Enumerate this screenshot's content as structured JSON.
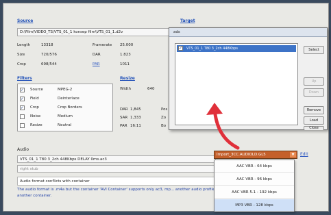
{
  "source": {
    "title": "Source",
    "path": "D:\\Film\\VIDEO_TS\\VTS_01_1 konsep film\\VTS_01_1.d2v",
    "length_label": "Length",
    "length_value": "13318",
    "framerate_label": "Framerate",
    "framerate_value": "25.000",
    "size_label": "Size",
    "size_value": "720/576",
    "dar_label": "DAR",
    "dar_value": "1.823",
    "crop_label": "Crop",
    "crop_value": "698/544",
    "par_label": "PAR",
    "par_value": "1011"
  },
  "target": {
    "title": "Target"
  },
  "filters": {
    "title": "Filters",
    "rows": [
      {
        "checked": true,
        "name": "Source",
        "value": "MPEG-2"
      },
      {
        "checked": true,
        "name": "Field",
        "value": "Deinterlace"
      },
      {
        "checked": true,
        "name": "Crop",
        "value": "Crop Borders"
      },
      {
        "checked": false,
        "name": "Noise",
        "value": "Medium"
      },
      {
        "checked": false,
        "name": "Resize",
        "value": "Neutral"
      }
    ]
  },
  "resize": {
    "title": "Resize",
    "width_label": "Width",
    "width_value": "640",
    "dar_label": "DAR",
    "dar_value": "1,845",
    "sar_label": "SAR",
    "sar_value": "1,333",
    "par_label": "PAR",
    "par_value": "16:11",
    "extra_labels": [
      "Pos",
      "Zo",
      "Bo"
    ]
  },
  "audio": {
    "title": "Audio",
    "track": "VTS_01_1 T80 3_2ch 448Kbps DELAY 0ms.ac3",
    "track2": "right stub",
    "compat_title": "Audio format conflicts with container",
    "warning": "The audio format is .m4a but the container 'AVI Container' supports only ac3, mp... another audio profile or another container."
  },
  "combo": {
    "value": "Import_3CC.AUDIOLD.GL5",
    "edit_label": "Edit"
  },
  "dropdown_items": [
    "AAC VBR - 64 kbps",
    "AAC VBR - 96 kbps",
    "AAC VBR 5.1 - 192 kbps",
    "MP3 VBR - 128 kbps"
  ],
  "popup": {
    "title": "ads",
    "list_item": "VTS_01_1 T80 3_2ch 448Kbps",
    "buttons": [
      "Select",
      "Up",
      "Down",
      "Remove",
      "Load",
      "Close"
    ]
  },
  "colors": {
    "arrow": "#e0303a",
    "combo": "#c4602b",
    "list_highlight": "#3d73c7",
    "link": "#2a55c0"
  }
}
